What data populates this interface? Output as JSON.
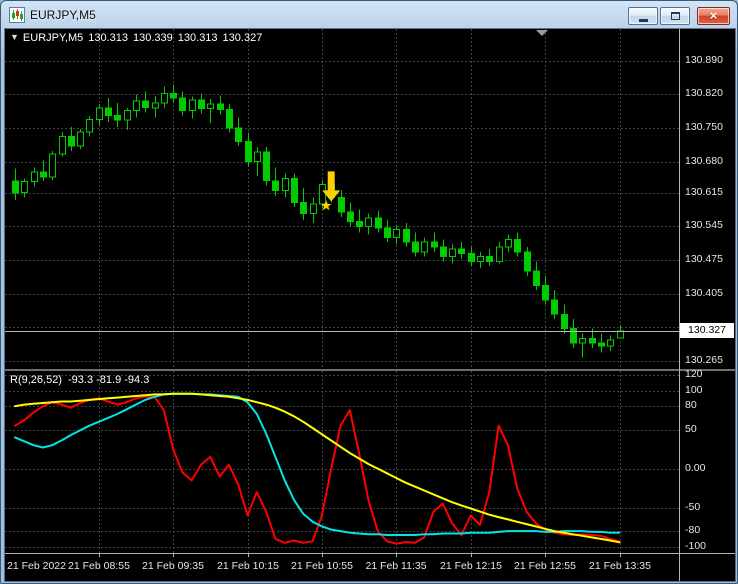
{
  "window": {
    "title": "EURJPY,M5",
    "close_glyph": "×"
  },
  "header": {
    "collapse_icon": "▼",
    "symbol": "EURJPY,M5",
    "open": "130.313",
    "high": "130.339",
    "low": "130.313",
    "close": "130.327"
  },
  "indicator_header": {
    "name": "R(9,26,52)",
    "values": "-93.3 -81.9 -94.3"
  },
  "chart_data": {
    "type": "candlestick",
    "symbol": "EURJPY",
    "timeframe": "M5",
    "colors": {
      "background": "#000000",
      "grid": "#3f3f3f",
      "candle": "#00cc00",
      "candle_bull_fill": "#000000",
      "price_line": "#b8b8b8",
      "axis_text": "#e6e6e6"
    },
    "price_axis": {
      "min": 130.248,
      "max": 130.956,
      "current_price": 130.327,
      "current_price_label": "130.327",
      "ticks": [
        {
          "value": 130.89,
          "label": "130.890"
        },
        {
          "value": 130.82,
          "label": "130.820"
        },
        {
          "value": 130.75,
          "label": "130.750"
        },
        {
          "value": 130.68,
          "label": "130.680"
        },
        {
          "value": 130.615,
          "label": "130.615"
        },
        {
          "value": 130.545,
          "label": "130.545"
        },
        {
          "value": 130.475,
          "label": "130.475"
        },
        {
          "value": 130.405,
          "label": "130.405"
        },
        {
          "value": 130.335,
          "label": ""
        },
        {
          "value": 130.265,
          "label": "130.265"
        }
      ]
    },
    "time_axis": {
      "ticks": [
        {
          "index": 2,
          "label": "21 Feb 2022",
          "grid": false,
          "align": "left"
        },
        {
          "index": 9,
          "label": "21 Feb 08:55",
          "grid": true
        },
        {
          "index": 17,
          "label": "21 Feb 09:35",
          "grid": true
        },
        {
          "index": 25,
          "label": "21 Feb 10:15",
          "grid": true
        },
        {
          "index": 33,
          "label": "21 Feb 10:55",
          "grid": true
        },
        {
          "index": 41,
          "label": "21 Feb 11:35",
          "grid": true
        },
        {
          "index": 49,
          "label": "21 Feb 12:15",
          "grid": true
        },
        {
          "index": 57,
          "label": "21 Feb 12:55",
          "grid": true
        },
        {
          "index": 65,
          "label": "21 Feb 13:35",
          "grid": true
        }
      ]
    },
    "candles": [
      [
        130.64,
        130.665,
        130.6,
        130.615
      ],
      [
        130.615,
        130.645,
        130.605,
        130.638
      ],
      [
        130.638,
        130.668,
        130.628,
        130.658
      ],
      [
        130.658,
        130.682,
        130.64,
        130.648
      ],
      [
        130.648,
        130.702,
        130.642,
        130.696
      ],
      [
        130.696,
        130.742,
        130.69,
        130.732
      ],
      [
        130.732,
        130.752,
        130.702,
        130.712
      ],
      [
        130.712,
        130.748,
        130.706,
        130.742
      ],
      [
        130.742,
        130.775,
        130.732,
        130.768
      ],
      [
        130.768,
        130.8,
        130.755,
        130.792
      ],
      [
        130.792,
        130.812,
        130.762,
        130.776
      ],
      [
        130.776,
        130.802,
        130.752,
        130.766
      ],
      [
        130.766,
        130.792,
        130.746,
        130.786
      ],
      [
        130.786,
        130.82,
        130.772,
        130.806
      ],
      [
        130.806,
        130.826,
        130.782,
        130.792
      ],
      [
        130.792,
        130.816,
        130.772,
        130.802
      ],
      [
        130.802,
        130.836,
        130.792,
        130.822
      ],
      [
        130.822,
        130.84,
        130.802,
        130.812
      ],
      [
        130.812,
        130.826,
        130.776,
        130.786
      ],
      [
        130.786,
        130.815,
        130.77,
        130.808
      ],
      [
        130.808,
        130.822,
        130.78,
        130.79
      ],
      [
        130.79,
        130.81,
        130.76,
        130.8
      ],
      [
        130.8,
        130.818,
        130.778,
        130.788
      ],
      [
        130.788,
        130.8,
        130.74,
        130.75
      ],
      [
        130.75,
        130.772,
        130.712,
        130.722
      ],
      [
        130.722,
        130.74,
        130.67,
        130.68
      ],
      [
        130.68,
        130.71,
        130.65,
        130.7
      ],
      [
        130.7,
        130.71,
        130.63,
        130.64
      ],
      [
        130.64,
        130.668,
        130.608,
        130.62
      ],
      [
        130.62,
        130.655,
        130.605,
        130.645
      ],
      [
        130.645,
        130.655,
        130.585,
        130.595
      ],
      [
        130.595,
        130.625,
        130.558,
        130.572
      ],
      [
        130.572,
        130.605,
        130.552,
        130.592
      ],
      [
        130.592,
        130.642,
        130.582,
        130.632
      ],
      [
        130.632,
        130.648,
        130.595,
        130.605
      ],
      [
        130.605,
        130.62,
        130.565,
        130.575
      ],
      [
        130.575,
        130.595,
        130.545,
        130.555
      ],
      [
        130.555,
        130.58,
        130.532,
        130.545
      ],
      [
        130.545,
        130.572,
        130.528,
        130.562
      ],
      [
        130.562,
        130.578,
        130.532,
        130.542
      ],
      [
        130.542,
        130.558,
        130.512,
        130.522
      ],
      [
        130.522,
        130.548,
        130.508,
        130.538
      ],
      [
        130.538,
        130.552,
        130.502,
        130.512
      ],
      [
        130.512,
        130.532,
        130.482,
        130.492
      ],
      [
        130.492,
        130.522,
        130.482,
        130.512
      ],
      [
        130.512,
        130.532,
        130.492,
        130.502
      ],
      [
        130.502,
        130.518,
        130.472,
        130.482
      ],
      [
        130.482,
        130.508,
        130.468,
        130.498
      ],
      [
        130.498,
        130.512,
        130.478,
        130.488
      ],
      [
        130.488,
        130.502,
        130.462,
        130.472
      ],
      [
        130.472,
        130.492,
        130.458,
        130.482
      ],
      [
        130.482,
        130.498,
        130.462,
        130.472
      ],
      [
        130.472,
        130.512,
        130.468,
        130.502
      ],
      [
        130.502,
        130.528,
        130.492,
        130.518
      ],
      [
        130.518,
        130.532,
        130.482,
        130.492
      ],
      [
        130.492,
        130.502,
        130.442,
        130.452
      ],
      [
        130.452,
        130.472,
        130.412,
        130.422
      ],
      [
        130.422,
        130.442,
        130.382,
        130.392
      ],
      [
        130.392,
        130.412,
        130.352,
        130.362
      ],
      [
        130.362,
        130.382,
        130.322,
        130.332
      ],
      [
        130.332,
        130.352,
        130.292,
        130.302
      ],
      [
        130.302,
        130.322,
        130.272,
        130.312
      ],
      [
        130.312,
        130.332,
        130.292,
        130.302
      ],
      [
        130.302,
        130.322,
        130.282,
        130.296
      ],
      [
        130.296,
        130.318,
        130.286,
        130.308
      ],
      [
        130.313,
        130.339,
        130.313,
        130.327
      ]
    ],
    "indicator": {
      "name": "R(9,26,52)",
      "current_values": [
        -93.3,
        -81.9,
        -94.3
      ],
      "axis": {
        "min": -108,
        "max": 125
      },
      "ticks": [
        {
          "value": 120,
          "label": "120"
        },
        {
          "value": 100,
          "label": "100"
        },
        {
          "value": 80,
          "label": "80"
        },
        {
          "value": 50,
          "label": "50"
        },
        {
          "value": 0,
          "label": "0.00"
        },
        {
          "value": -50,
          "label": "-50"
        },
        {
          "value": -80,
          "label": "-80"
        },
        {
          "value": -100,
          "label": "-100"
        }
      ],
      "series": [
        {
          "name": "red",
          "color": "#ff0000",
          "values": [
            55,
            62,
            72,
            80,
            85,
            82,
            78,
            84,
            88,
            90,
            86,
            82,
            85,
            90,
            92,
            92,
            75,
            25,
            -5,
            -15,
            5,
            15,
            -10,
            5,
            -20,
            -60,
            -30,
            -55,
            -90,
            -95,
            -92,
            -95,
            -93,
            -60,
            0,
            55,
            75,
            20,
            -40,
            -80,
            -93,
            -96,
            -94,
            -95,
            -88,
            -55,
            -45,
            -70,
            -85,
            -60,
            -72,
            -30,
            55,
            30,
            -25,
            -55,
            -70,
            -78,
            -82,
            -84,
            -85,
            -84,
            -85,
            -86,
            -90,
            -93.3
          ]
        },
        {
          "name": "aqua",
          "color": "#00e6e6",
          "values": [
            40,
            35,
            30,
            27,
            30,
            36,
            43,
            49,
            55,
            60,
            65,
            70,
            76,
            82,
            88,
            92,
            95,
            96,
            96,
            96,
            95,
            95,
            94,
            93,
            92,
            85,
            70,
            45,
            15,
            -15,
            -40,
            -58,
            -68,
            -74,
            -78,
            -80,
            -82,
            -83,
            -84,
            -84,
            -85,
            -85,
            -85,
            -85,
            -84,
            -84,
            -83,
            -83,
            -83,
            -82,
            -82,
            -82,
            -81,
            -80,
            -80,
            -80,
            -80,
            -81,
            -81,
            -80,
            -80,
            -80,
            -81,
            -81,
            -82,
            -81.9
          ]
        },
        {
          "name": "yellow",
          "color": "#ffff00",
          "values": [
            80,
            82,
            83,
            84,
            85,
            86,
            86,
            87,
            88,
            89,
            90,
            91,
            92,
            93,
            94,
            95,
            95,
            96,
            96,
            96,
            95,
            94,
            93,
            92,
            90,
            88,
            85,
            82,
            78,
            73,
            67,
            60,
            52,
            44,
            36,
            28,
            20,
            13,
            6,
            0,
            -6,
            -12,
            -18,
            -23,
            -28,
            -33,
            -38,
            -43,
            -47,
            -51,
            -55,
            -59,
            -62,
            -65,
            -68,
            -71,
            -74,
            -77,
            -80,
            -82,
            -84,
            -86,
            -88,
            -90,
            -92,
            -94.3
          ]
        }
      ]
    },
    "annotations": {
      "arrow": {
        "candle_index": 34,
        "tip_price": 130.597,
        "color": "#ffd000"
      },
      "star": {
        "candle_index": 34,
        "price": 130.588,
        "color": "#ffd000"
      }
    }
  }
}
